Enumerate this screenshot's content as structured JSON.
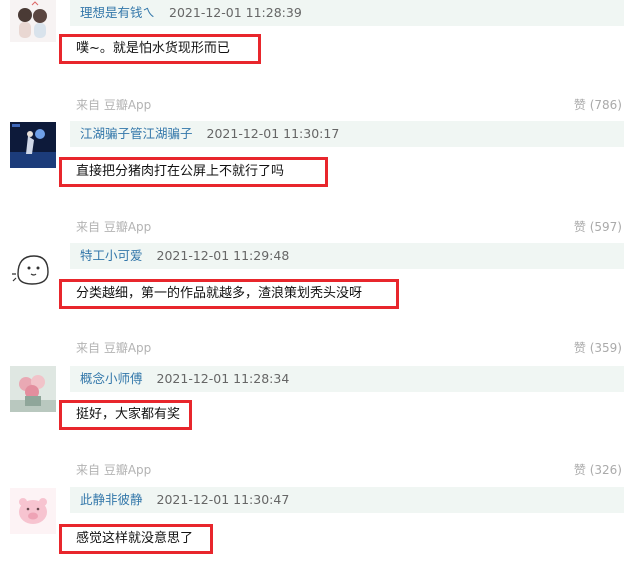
{
  "comments": [
    {
      "author": "理想是有钱ㄟ",
      "time": "2021-12-01 11:28:39",
      "content": "噗~。就是怕水货现形而已",
      "source": "来自 豆瓣App",
      "likes": "赞 (786)",
      "avatar": "avatar-cartoon-couple"
    },
    {
      "author": "江湖骗子管江湖骗子",
      "time": "2021-12-01 11:30:17",
      "content": "直接把分猪肉打在公屏上不就行了吗",
      "source": "来自 豆瓣App",
      "likes": "赞 (597)",
      "avatar": "avatar-stage-figure"
    },
    {
      "author": "特工小可爱",
      "time": "2021-12-01 11:29:48",
      "content": "分类越细，第一的作品就越多，渣浪策划秃头没呀",
      "source": "来自 豆瓣App",
      "likes": "赞 (359)",
      "avatar": "avatar-doodle-face"
    },
    {
      "author": "概念小师傅",
      "time": "2021-12-01 11:28:34",
      "content": "挺好，大家都有奖",
      "source": "来自 豆瓣App",
      "likes": "赞 (326)",
      "avatar": "avatar-flowers"
    },
    {
      "author": "此静非彼静",
      "time": "2021-12-01 11:30:47",
      "content": "感觉这样就没意思了",
      "avatar": "avatar-pink-pig"
    }
  ]
}
